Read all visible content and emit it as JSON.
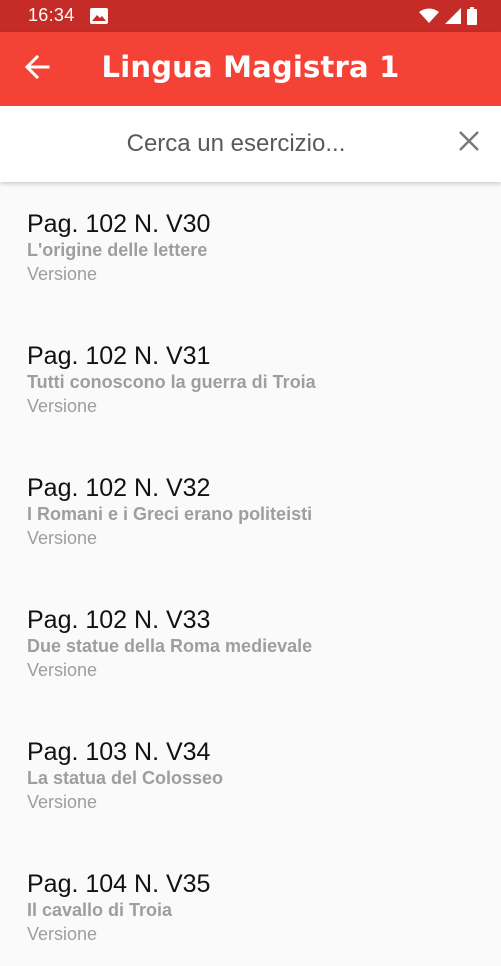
{
  "status_bar": {
    "time": "16:34",
    "icons": [
      "image-icon",
      "wifi-icon",
      "signal-icon",
      "battery-icon"
    ]
  },
  "app_bar": {
    "title": "Lingua Magistra 1",
    "back_icon": "arrow-back-icon",
    "color": "#f44336"
  },
  "search": {
    "placeholder": "Cerca un esercizio...",
    "value": "",
    "clear_icon": "close-icon"
  },
  "exercises": [
    {
      "title": "Pag. 102 N. V30",
      "subtitle": "L'origine delle lettere",
      "type": "Versione"
    },
    {
      "title": "Pag. 102 N. V31",
      "subtitle": "Tutti conoscono la guerra di Troia",
      "type": "Versione"
    },
    {
      "title": "Pag. 102 N. V32",
      "subtitle": "I Romani e i Greci erano politeisti",
      "type": "Versione"
    },
    {
      "title": "Pag. 102 N. V33",
      "subtitle": "Due statue della Roma medievale",
      "type": "Versione"
    },
    {
      "title": "Pag. 103 N. V34",
      "subtitle": "La statua del Colosseo",
      "type": "Versione"
    },
    {
      "title": "Pag. 104 N. V35",
      "subtitle": "Il cavallo di Troia",
      "type": "Versione"
    }
  ]
}
